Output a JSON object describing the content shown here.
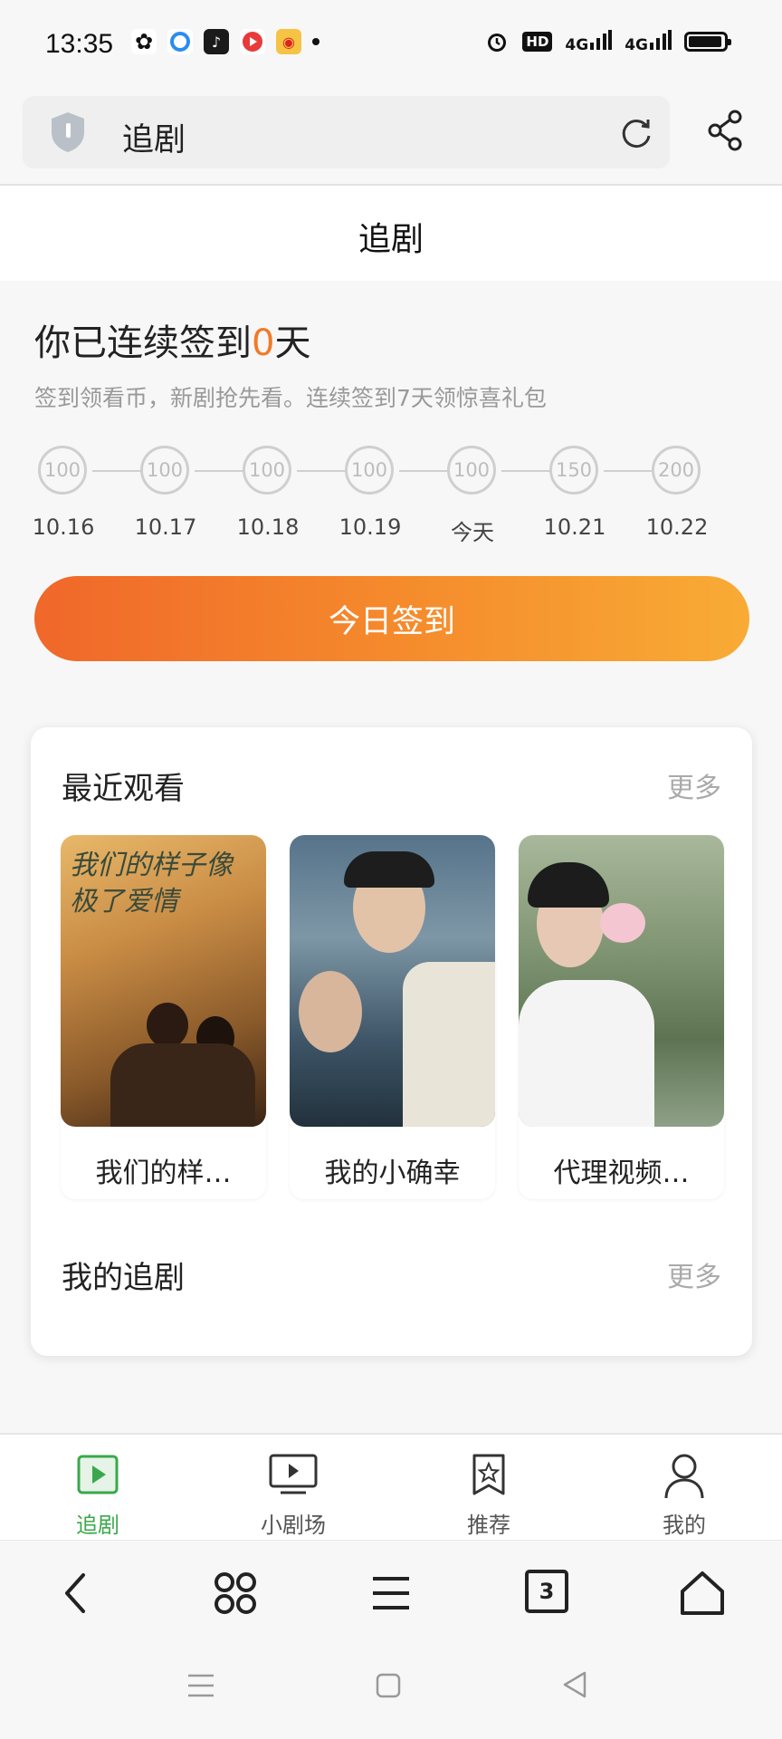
{
  "status_bar": {
    "time": "13:35",
    "network_1": "4G",
    "network_2": "4G",
    "hd": "HD"
  },
  "url_bar": {
    "text": "追剧"
  },
  "page": {
    "title": "追剧"
  },
  "checkin": {
    "streak_prefix": "你已连续签到",
    "streak_days": "0",
    "streak_suffix": "天",
    "subtitle": "签到领看币，新剧抢先看。连续签到7天领惊喜礼包",
    "days": [
      {
        "points": "100",
        "label": "10.16"
      },
      {
        "points": "100",
        "label": "10.17"
      },
      {
        "points": "100",
        "label": "10.18"
      },
      {
        "points": "100",
        "label": "10.19"
      },
      {
        "points": "100",
        "label": "今天"
      },
      {
        "points": "150",
        "label": "10.21"
      },
      {
        "points": "200",
        "label": "10.22"
      }
    ],
    "button_label": "今日签到"
  },
  "recent": {
    "title": "最近观看",
    "more": "更多",
    "items": [
      {
        "caption": "我们的样…",
        "poster_text": "我们的样子像极了爱情"
      },
      {
        "caption": "我的小确幸"
      },
      {
        "caption": "代理视频…"
      }
    ]
  },
  "my_dramas": {
    "title": "我的追剧",
    "more": "更多"
  },
  "tabs": [
    {
      "label": "追剧",
      "active": true
    },
    {
      "label": "小剧场",
      "active": false
    },
    {
      "label": "推荐",
      "active": false
    },
    {
      "label": "我的",
      "active": false
    }
  ],
  "browser": {
    "tab_count": "3"
  },
  "colors": {
    "accent_orange": "#f27a26",
    "tab_active_green": "#3aa84a"
  }
}
